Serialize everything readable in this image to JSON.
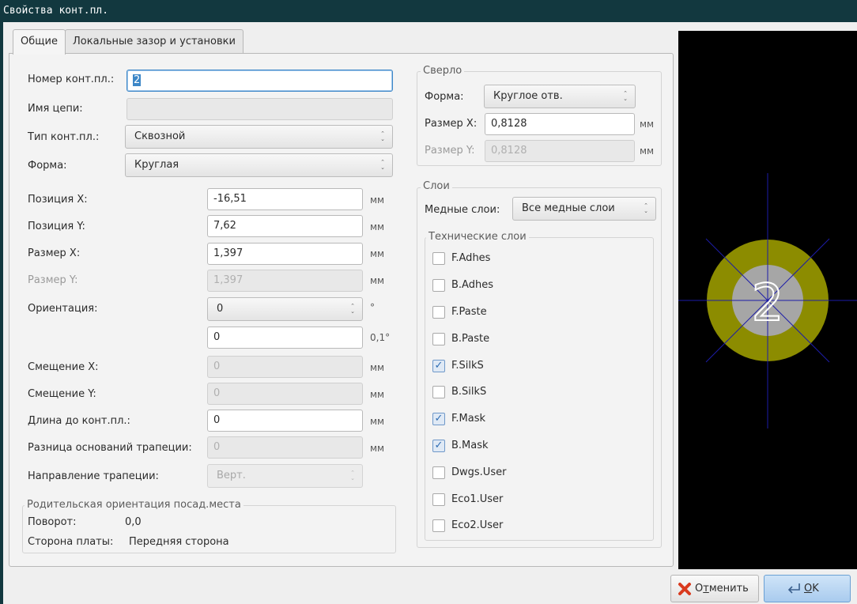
{
  "window": {
    "title": "Свойства конт.пл."
  },
  "tabs": [
    {
      "label": "Общие",
      "active": true
    },
    {
      "label": "Локальные зазор и установки",
      "active": false
    }
  ],
  "general": {
    "pad_number": {
      "label": "Номер конт.пл.:",
      "value": "2"
    },
    "net_name": {
      "label": "Имя цепи:",
      "value": ""
    },
    "pad_type": {
      "label": "Тип конт.пл.:",
      "value": "Сквозной"
    },
    "shape": {
      "label": "Форма:",
      "value": "Круглая"
    },
    "pos_x": {
      "label": "Позиция X:",
      "value": "-16,51",
      "unit": "мм"
    },
    "pos_y": {
      "label": "Позиция Y:",
      "value": "7,62",
      "unit": "мм"
    },
    "size_x": {
      "label": "Размер X:",
      "value": "1,397",
      "unit": "мм"
    },
    "size_y": {
      "label": "Размер Y:",
      "value": "1,397",
      "unit": "мм"
    },
    "orientation": {
      "label": "Ориентация:",
      "value": "0",
      "unit": "°",
      "value2": "0",
      "unit2": "0,1°"
    },
    "offset_x": {
      "label": "Смещение X:",
      "value": "0",
      "unit": "мм"
    },
    "offset_y": {
      "label": "Смещение Y:",
      "value": "0",
      "unit": "мм"
    },
    "die_length": {
      "label": "Длина до конт.пл.:",
      "value": "0",
      "unit": "мм"
    },
    "trap_delta": {
      "label": "Разница оснований трапеции:",
      "value": "0",
      "unit": "мм"
    },
    "trap_direction": {
      "label": "Направление трапеции:",
      "value": "Верт."
    }
  },
  "parent": {
    "title": "Родительская ориентация посад.места",
    "rotation_label": "Поворот:",
    "rotation_value": "0,0",
    "side_label": "Сторона платы:",
    "side_value": "Передняя сторона"
  },
  "drill": {
    "title": "Сверло",
    "shape_label": "Форма:",
    "shape_value": "Круглое отв.",
    "size_x_label": "Размер X:",
    "size_x_value": "0,8128",
    "size_y_label": "Размер Y:",
    "size_y_value": "0,8128",
    "unit": "мм"
  },
  "layers": {
    "title": "Слои",
    "copper_label": "Медные слои:",
    "copper_value": "Все медные слои",
    "tech_title": "Технические слои",
    "items": [
      {
        "label": "F.Adhes",
        "checked": false
      },
      {
        "label": "B.Adhes",
        "checked": false
      },
      {
        "label": "F.Paste",
        "checked": false
      },
      {
        "label": "B.Paste",
        "checked": false
      },
      {
        "label": "F.SilkS",
        "checked": true
      },
      {
        "label": "B.SilkS",
        "checked": false
      },
      {
        "label": "F.Mask",
        "checked": true
      },
      {
        "label": "B.Mask",
        "checked": true
      },
      {
        "label": "Dwgs.User",
        "checked": false
      },
      {
        "label": "Eco1.User",
        "checked": false
      },
      {
        "label": "Eco2.User",
        "checked": false
      }
    ]
  },
  "preview": {
    "pad_label": "2",
    "pad_color": "#8c8c00",
    "hole_color": "#a6a6a6",
    "axis_color": "#1c1ca8"
  },
  "buttons": {
    "cancel_first": "О",
    "cancel_accel": "т",
    "cancel_rest": "менить",
    "ok_accel": "O",
    "ok_rest": "K"
  }
}
